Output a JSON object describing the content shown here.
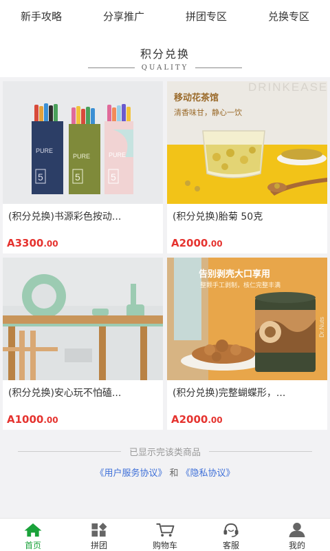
{
  "top_nav": [
    {
      "label": "新手攻略"
    },
    {
      "label": "分享推广"
    },
    {
      "label": "拼团专区"
    },
    {
      "label": "兑换专区"
    }
  ],
  "section": {
    "title": "积分兑换",
    "subtitle": "QUALITY"
  },
  "products": [
    {
      "name": "(积分兑换)书源彩色按动...",
      "price_int": "A3300",
      "price_dec": ".00",
      "image": "pens-photo",
      "image_text": "PURE",
      "image_number": "5"
    },
    {
      "name": "(积分兑换)胎菊 50克",
      "price_int": "A2000",
      "price_dec": ".00",
      "image": "chrysanthemum-tea-photo",
      "image_title": "移动花茶馆",
      "image_subtitle": "清香味甘，静心一饮",
      "image_watermark": "DRINKEASE"
    },
    {
      "name": "(积分兑换)安心玩不怕磕...",
      "price_int": "A1000",
      "price_dec": ".00",
      "image": "table-edge-guard-photo"
    },
    {
      "name": "(积分兑换)完整蝴蝶形，...",
      "price_int": "A2000",
      "price_dec": ".00",
      "image": "walnuts-photo",
      "image_title": "告别剥壳大口享用",
      "image_subtitle": "整颗手工剥制，核仁完整丰满",
      "image_brand": "Dr.Nuts"
    }
  ],
  "end_notice": "已显示完该类商品",
  "agreements": {
    "user_agreement": "《用户服务协议》",
    "and": "和",
    "privacy": "《隐私协议》"
  },
  "tabbar": [
    {
      "label": "首页",
      "icon": "home-icon",
      "active": true
    },
    {
      "label": "拼团",
      "icon": "group-grid-icon",
      "active": false
    },
    {
      "label": "购物车",
      "icon": "cart-icon",
      "active": false
    },
    {
      "label": "客服",
      "icon": "headset-icon",
      "active": false
    },
    {
      "label": "我的",
      "icon": "user-icon",
      "active": false
    }
  ],
  "colors": {
    "accent_green": "#1aa23a",
    "price_red": "#e5332f",
    "link_blue": "#3d6fd8"
  }
}
